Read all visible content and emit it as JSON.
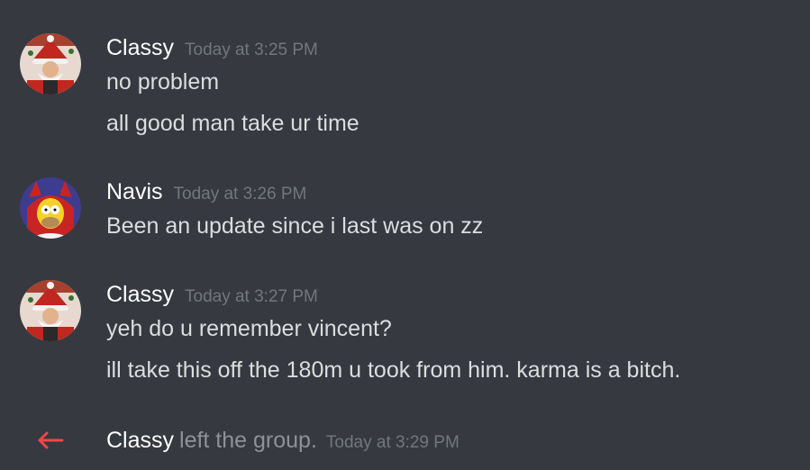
{
  "messages": [
    {
      "user": "Classy",
      "avatar_icon": "santa-avatar-icon",
      "timestamp": "Today at 3:25 PM",
      "lines": [
        "no problem",
        "all good man take ur time"
      ]
    },
    {
      "user": "Navis",
      "avatar_icon": "homer-devil-avatar-icon",
      "timestamp": "Today at 3:26 PM",
      "lines": [
        "Been an update since i last was on zz"
      ]
    },
    {
      "user": "Classy",
      "avatar_icon": "santa-avatar-icon",
      "timestamp": "Today at 3:27 PM",
      "lines": [
        "yeh do u remember vincent?",
        "ill take this off the 180m u took from him. karma is a bitch."
      ]
    }
  ],
  "system_message": {
    "icon": "left-arrow-icon",
    "icon_color": "#f04747",
    "user": "Classy",
    "text": "left the group.",
    "timestamp": "Today at 3:29 PM"
  },
  "colors": {
    "background": "#36393f",
    "username": "#ffffff",
    "message_text": "#dcddde",
    "timestamp": "#72767d"
  }
}
